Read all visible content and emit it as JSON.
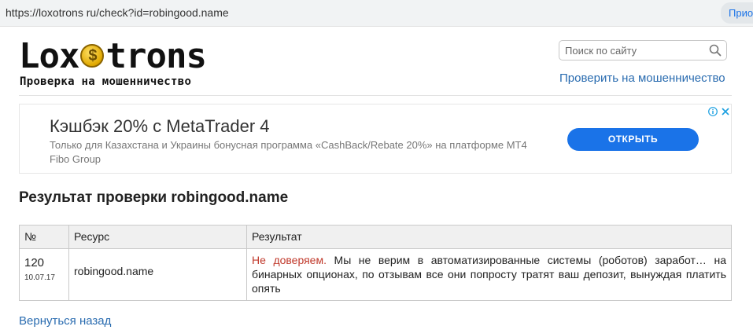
{
  "browser": {
    "url": "https://loxotrons ru/check?id=robingood.name",
    "right_button": "Прио"
  },
  "header": {
    "logo_part1": "Lox",
    "logo_part2": "trons",
    "tagline": "Проверка на мошенничество",
    "search_placeholder": "Поиск по сайту",
    "check_link": "Проверить на мошенничество"
  },
  "ad": {
    "title": "Кэшбэк 20% с MetaTrader 4",
    "description": "Только для Казахстана и Украины бонусная программа «CashBack/Rebate 20%» на платформе MT4 Fibo Group",
    "button_label": "ОТКРЫТЬ"
  },
  "result": {
    "title": "Результат проверки robingood.name",
    "columns": [
      "№",
      "Ресурс",
      "Результат"
    ],
    "rows": [
      {
        "number": "120",
        "date": "10.07.17",
        "resource": "robingood.name",
        "verdict": "Не доверяем.",
        "comment": " Мы не верим в автоматизированные системы (роботов) заработ… на бинарных опционах, по отзывам все они попросту тратят ваш депозит, вынуждая платить опять"
      }
    ]
  },
  "back_link": "Вернуться назад",
  "colors": {
    "link": "#2a6cb0",
    "verdict": "#c0392b",
    "ad_button": "#1a73e8"
  }
}
